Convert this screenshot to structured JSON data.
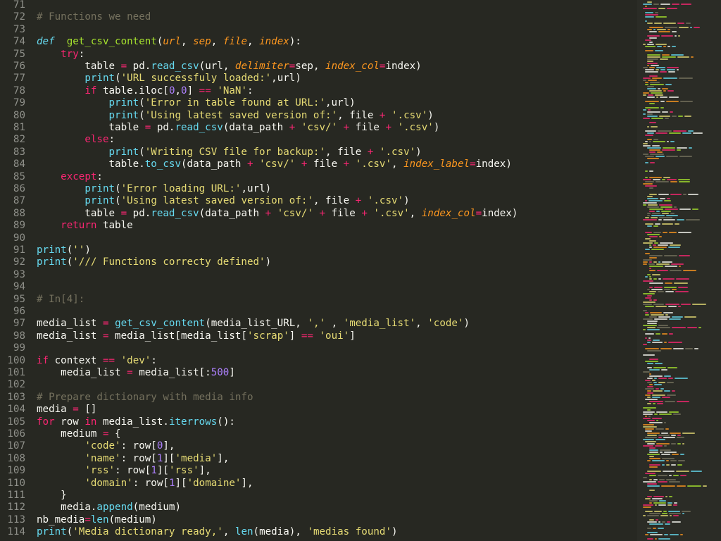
{
  "colors": {
    "background": "#272822",
    "text": "#f8f8f2",
    "keyword": "#f92672",
    "storage": "#66d9ef",
    "function": "#a6e22e",
    "builtin": "#66d9ef",
    "string": "#e6db74",
    "number": "#ae81ff",
    "comment": "#75715e",
    "param": "#fd971f",
    "line_number": "#8f908a"
  },
  "editor": {
    "lines": [
      {
        "n": "71",
        "t": []
      },
      {
        "n": "72",
        "t": [
          [
            "c",
            "# Functions we need"
          ]
        ]
      },
      {
        "n": "73",
        "t": []
      },
      {
        "n": "74",
        "t": [
          [
            "s",
            "def"
          ],
          [
            "",
            "  "
          ],
          [
            "f",
            "get_csv_content"
          ],
          [
            "",
            "("
          ],
          [
            "p",
            "url"
          ],
          [
            "",
            ", "
          ],
          [
            "p",
            "sep"
          ],
          [
            "",
            ", "
          ],
          [
            "p",
            "file"
          ],
          [
            "",
            ", "
          ],
          [
            "p",
            "index"
          ],
          [
            "",
            "):"
          ]
        ]
      },
      {
        "n": "75",
        "t": [
          [
            "",
            "    "
          ],
          [
            "k",
            "try"
          ],
          [
            "",
            ":"
          ]
        ]
      },
      {
        "n": "76",
        "t": [
          [
            "",
            "        table "
          ],
          [
            "k",
            "="
          ],
          [
            "",
            " pd."
          ],
          [
            "b",
            "read_csv"
          ],
          [
            "",
            "(url, "
          ],
          [
            "p",
            "delimiter"
          ],
          [
            "k",
            "="
          ],
          [
            "",
            "sep, "
          ],
          [
            "p",
            "index_col"
          ],
          [
            "k",
            "="
          ],
          [
            "",
            "index)"
          ]
        ]
      },
      {
        "n": "77",
        "t": [
          [
            "",
            "        "
          ],
          [
            "b",
            "print"
          ],
          [
            "",
            "("
          ],
          [
            "q",
            "'URL successfuly loaded:'"
          ],
          [
            "",
            ",url)"
          ]
        ]
      },
      {
        "n": "78",
        "t": [
          [
            "",
            "        "
          ],
          [
            "k",
            "if"
          ],
          [
            "",
            " table.iloc["
          ],
          [
            "m",
            "0"
          ],
          [
            "",
            ","
          ],
          [
            "m",
            "0"
          ],
          [
            "",
            "] "
          ],
          [
            "k",
            "=="
          ],
          [
            "",
            " "
          ],
          [
            "q",
            "'NaN'"
          ],
          [
            "",
            ":"
          ]
        ]
      },
      {
        "n": "79",
        "t": [
          [
            "",
            "            "
          ],
          [
            "b",
            "print"
          ],
          [
            "",
            "("
          ],
          [
            "q",
            "'Error in table found at URL:'"
          ],
          [
            "",
            ",url)"
          ]
        ]
      },
      {
        "n": "80",
        "t": [
          [
            "",
            "            "
          ],
          [
            "b",
            "print"
          ],
          [
            "",
            "("
          ],
          [
            "q",
            "'Using latest saved version of:'"
          ],
          [
            "",
            ", file "
          ],
          [
            "k",
            "+"
          ],
          [
            "",
            " "
          ],
          [
            "q",
            "'.csv'"
          ],
          [
            "",
            ")"
          ]
        ]
      },
      {
        "n": "81",
        "t": [
          [
            "",
            "            table "
          ],
          [
            "k",
            "="
          ],
          [
            "",
            " pd."
          ],
          [
            "b",
            "read_csv"
          ],
          [
            "",
            "(data_path "
          ],
          [
            "k",
            "+"
          ],
          [
            "",
            " "
          ],
          [
            "q",
            "'csv/'"
          ],
          [
            "",
            " "
          ],
          [
            "k",
            "+"
          ],
          [
            "",
            " file "
          ],
          [
            "k",
            "+"
          ],
          [
            "",
            " "
          ],
          [
            "q",
            "'.csv'"
          ],
          [
            "",
            ")"
          ]
        ]
      },
      {
        "n": "82",
        "t": [
          [
            "",
            "        "
          ],
          [
            "k",
            "else"
          ],
          [
            "",
            ":"
          ]
        ]
      },
      {
        "n": "83",
        "t": [
          [
            "",
            "            "
          ],
          [
            "b",
            "print"
          ],
          [
            "",
            "("
          ],
          [
            "q",
            "'Writing CSV file for backup:'"
          ],
          [
            "",
            ", file "
          ],
          [
            "k",
            "+"
          ],
          [
            "",
            " "
          ],
          [
            "q",
            "'.csv'"
          ],
          [
            "",
            ")"
          ]
        ]
      },
      {
        "n": "84",
        "t": [
          [
            "",
            "            table."
          ],
          [
            "b",
            "to_csv"
          ],
          [
            "",
            "(data_path "
          ],
          [
            "k",
            "+"
          ],
          [
            "",
            " "
          ],
          [
            "q",
            "'csv/'"
          ],
          [
            "",
            " "
          ],
          [
            "k",
            "+"
          ],
          [
            "",
            " file "
          ],
          [
            "k",
            "+"
          ],
          [
            "",
            " "
          ],
          [
            "q",
            "'.csv'"
          ],
          [
            "",
            ", "
          ],
          [
            "p",
            "index_label"
          ],
          [
            "k",
            "="
          ],
          [
            "",
            "index)"
          ]
        ]
      },
      {
        "n": "85",
        "t": [
          [
            "",
            "    "
          ],
          [
            "k",
            "except"
          ],
          [
            "",
            ":"
          ]
        ]
      },
      {
        "n": "86",
        "t": [
          [
            "",
            "        "
          ],
          [
            "b",
            "print"
          ],
          [
            "",
            "("
          ],
          [
            "q",
            "'Error loading URL:'"
          ],
          [
            "",
            ",url)"
          ]
        ]
      },
      {
        "n": "87",
        "t": [
          [
            "",
            "        "
          ],
          [
            "b",
            "print"
          ],
          [
            "",
            "("
          ],
          [
            "q",
            "'Using latest saved version of:'"
          ],
          [
            "",
            ", file "
          ],
          [
            "k",
            "+"
          ],
          [
            "",
            " "
          ],
          [
            "q",
            "'.csv'"
          ],
          [
            "",
            ")"
          ]
        ]
      },
      {
        "n": "88",
        "t": [
          [
            "",
            "        table "
          ],
          [
            "k",
            "="
          ],
          [
            "",
            " pd."
          ],
          [
            "b",
            "read_csv"
          ],
          [
            "",
            "(data_path "
          ],
          [
            "k",
            "+"
          ],
          [
            "",
            " "
          ],
          [
            "q",
            "'csv/'"
          ],
          [
            "",
            " "
          ],
          [
            "k",
            "+"
          ],
          [
            "",
            " file "
          ],
          [
            "k",
            "+"
          ],
          [
            "",
            " "
          ],
          [
            "q",
            "'.csv'"
          ],
          [
            "",
            ", "
          ],
          [
            "p",
            "index_col"
          ],
          [
            "k",
            "="
          ],
          [
            "",
            "index)"
          ]
        ]
      },
      {
        "n": "89",
        "t": [
          [
            "",
            "    "
          ],
          [
            "k",
            "return"
          ],
          [
            "",
            " table"
          ]
        ]
      },
      {
        "n": "90",
        "t": []
      },
      {
        "n": "91",
        "t": [
          [
            "b",
            "print"
          ],
          [
            "",
            "("
          ],
          [
            "q",
            "''"
          ],
          [
            "",
            ")"
          ]
        ]
      },
      {
        "n": "92",
        "t": [
          [
            "b",
            "print"
          ],
          [
            "",
            "("
          ],
          [
            "q",
            "'/// Functions correcty defined'"
          ],
          [
            "",
            ")"
          ]
        ]
      },
      {
        "n": "93",
        "t": []
      },
      {
        "n": "94",
        "t": []
      },
      {
        "n": "95",
        "t": [
          [
            "c",
            "# In[4]:"
          ]
        ]
      },
      {
        "n": "96",
        "t": []
      },
      {
        "n": "97",
        "t": [
          [
            "",
            "media_list "
          ],
          [
            "k",
            "="
          ],
          [
            "",
            " "
          ],
          [
            "b",
            "get_csv_content"
          ],
          [
            "",
            "(media_list_URL, "
          ],
          [
            "q",
            "','"
          ],
          [
            "",
            " , "
          ],
          [
            "q",
            "'media_list'"
          ],
          [
            "",
            ", "
          ],
          [
            "q",
            "'code'"
          ],
          [
            "",
            ")"
          ]
        ]
      },
      {
        "n": "98",
        "t": [
          [
            "",
            "media_list "
          ],
          [
            "k",
            "="
          ],
          [
            "",
            " media_list[media_list["
          ],
          [
            "q",
            "'scrap'"
          ],
          [
            "",
            "] "
          ],
          [
            "k",
            "=="
          ],
          [
            "",
            " "
          ],
          [
            "q",
            "'oui'"
          ],
          [
            "",
            "]"
          ]
        ]
      },
      {
        "n": "99",
        "t": []
      },
      {
        "n": "100",
        "t": [
          [
            "k",
            "if"
          ],
          [
            "",
            " context "
          ],
          [
            "k",
            "=="
          ],
          [
            "",
            " "
          ],
          [
            "q",
            "'dev'"
          ],
          [
            "",
            ":"
          ]
        ]
      },
      {
        "n": "101",
        "t": [
          [
            "",
            "    media_list "
          ],
          [
            "k",
            "="
          ],
          [
            "",
            " media_list[:"
          ],
          [
            "m",
            "500"
          ],
          [
            "",
            "]"
          ]
        ]
      },
      {
        "n": "102",
        "t": []
      },
      {
        "n": "103",
        "t": [
          [
            "c",
            "# Prepare dictionary with media info"
          ]
        ]
      },
      {
        "n": "104",
        "t": [
          [
            "",
            "media "
          ],
          [
            "k",
            "="
          ],
          [
            "",
            " []"
          ]
        ]
      },
      {
        "n": "105",
        "t": [
          [
            "k",
            "for"
          ],
          [
            "",
            " row "
          ],
          [
            "k",
            "in"
          ],
          [
            "",
            " media_list."
          ],
          [
            "b",
            "iterrows"
          ],
          [
            "",
            "():"
          ]
        ]
      },
      {
        "n": "106",
        "t": [
          [
            "",
            "    medium "
          ],
          [
            "k",
            "="
          ],
          [
            "",
            " {"
          ]
        ]
      },
      {
        "n": "107",
        "t": [
          [
            "",
            "        "
          ],
          [
            "q",
            "'code'"
          ],
          [
            "",
            ": row["
          ],
          [
            "m",
            "0"
          ],
          [
            "",
            "],"
          ]
        ]
      },
      {
        "n": "108",
        "t": [
          [
            "",
            "        "
          ],
          [
            "q",
            "'name'"
          ],
          [
            "",
            ": row["
          ],
          [
            "m",
            "1"
          ],
          [
            "",
            "]["
          ],
          [
            "q",
            "'media'"
          ],
          [
            "",
            "],"
          ]
        ]
      },
      {
        "n": "109",
        "t": [
          [
            "",
            "        "
          ],
          [
            "q",
            "'rss'"
          ],
          [
            "",
            ": row["
          ],
          [
            "m",
            "1"
          ],
          [
            "",
            "]["
          ],
          [
            "q",
            "'rss'"
          ],
          [
            "",
            "],"
          ]
        ]
      },
      {
        "n": "110",
        "t": [
          [
            "",
            "        "
          ],
          [
            "q",
            "'domain'"
          ],
          [
            "",
            ": row["
          ],
          [
            "m",
            "1"
          ],
          [
            "",
            "]["
          ],
          [
            "q",
            "'domaine'"
          ],
          [
            "",
            "],"
          ]
        ]
      },
      {
        "n": "111",
        "t": [
          [
            "",
            "    }"
          ]
        ]
      },
      {
        "n": "112",
        "t": [
          [
            "",
            "    media."
          ],
          [
            "b",
            "append"
          ],
          [
            "",
            "(medium)"
          ]
        ]
      },
      {
        "n": "113",
        "t": [
          [
            "",
            "nb_media"
          ],
          [
            "k",
            "="
          ],
          [
            "b",
            "len"
          ],
          [
            "",
            "(medium)"
          ]
        ]
      },
      {
        "n": "114",
        "t": [
          [
            "b",
            "print"
          ],
          [
            "",
            "("
          ],
          [
            "q",
            "'Media dictionary ready,'"
          ],
          [
            "",
            ", "
          ],
          [
            "b",
            "len"
          ],
          [
            "",
            "(media), "
          ],
          [
            "q",
            "'medias found'"
          ],
          [
            "",
            ")"
          ]
        ]
      }
    ]
  }
}
